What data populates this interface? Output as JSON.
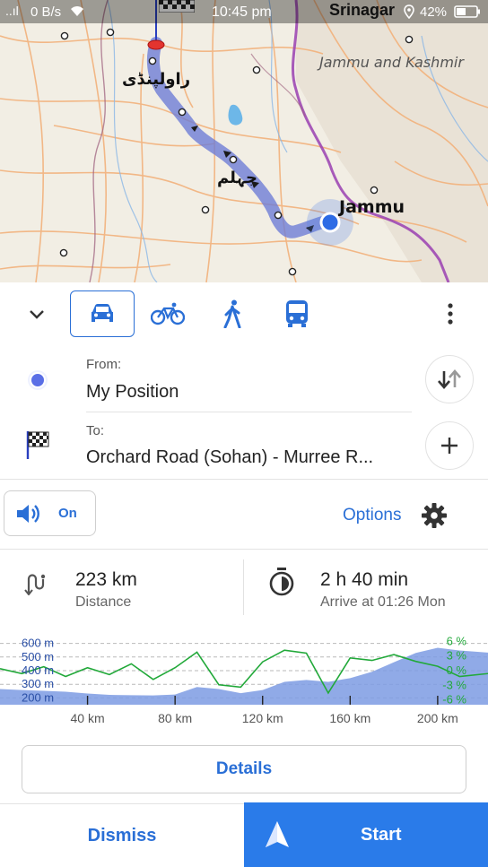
{
  "status_bar": {
    "signal": "..ıl",
    "net_speed": "0 B/s",
    "time": "10:45 pm",
    "location_label": "Srinagar",
    "battery": "42%"
  },
  "map": {
    "labels": {
      "region": "Jammu and Kashmir",
      "city_jammu": "Jammu",
      "city_rawalpindi": "راولپنڈی",
      "city_jhelum": "جہلم"
    }
  },
  "transport_modes": [
    {
      "name": "car",
      "icon": "car-icon",
      "selected": true
    },
    {
      "name": "bicycle",
      "icon": "bicycle-icon",
      "selected": false
    },
    {
      "name": "pedestrian",
      "icon": "walk-icon",
      "selected": false
    },
    {
      "name": "public-transport",
      "icon": "bus-icon",
      "selected": false
    }
  ],
  "route": {
    "from_label": "From:",
    "from_value": "My Position",
    "to_label": "To:",
    "to_value": "Orchard Road (Sohan) - Murree R..."
  },
  "voice": {
    "label": "On"
  },
  "options_label": "Options",
  "stats": {
    "distance_value": "223 km",
    "distance_label": "Distance",
    "time_value": "2 h 40 min",
    "time_label": "Arrive at 01:26 Mon"
  },
  "chart_data": {
    "type": "area",
    "title": "",
    "xlabel": "",
    "ylabel": "",
    "x_ticks": [
      "40 km",
      "80 km",
      "120 km",
      "160 km",
      "200 km"
    ],
    "y_ticks_left": [
      "600 m",
      "500 m",
      "400 m",
      "300 m",
      "200 m"
    ],
    "y_ticks_right": [
      "6 %",
      "3 %",
      "0 %",
      "-3 %",
      "-6 %"
    ],
    "xlim": [
      0,
      223
    ],
    "ylim": [
      150,
      650
    ],
    "series": [
      {
        "x": [
          0,
          10,
          20,
          30,
          40,
          50,
          60,
          70,
          80,
          90,
          100,
          110,
          120,
          130,
          140,
          150,
          160,
          170,
          180,
          190,
          200,
          210,
          223
        ],
        "values": [
          265,
          258,
          252,
          245,
          232,
          222,
          220,
          218,
          225,
          280,
          265,
          235,
          258,
          318,
          332,
          318,
          345,
          392,
          462,
          530,
          568,
          548,
          532
        ]
      },
      {
        "x": [
          0,
          10,
          20,
          30,
          40,
          50,
          60,
          70,
          80,
          90,
          100,
          110,
          120,
          130,
          140,
          150,
          160,
          170,
          180,
          190,
          200,
          210,
          223
        ],
        "values": [
          0.4,
          -0.6,
          0.8,
          -1.2,
          0.6,
          -0.8,
          1.4,
          -1.8,
          0.6,
          3.8,
          -2.9,
          -3.4,
          1.8,
          4.2,
          3.6,
          -4.6,
          2.6,
          2.1,
          3.3,
          1.9,
          0.9,
          -1.2,
          -0.6
        ]
      }
    ]
  },
  "buttons": {
    "details": "Details",
    "dismiss": "Dismiss",
    "start": "Start"
  },
  "colors": {
    "accent": "#2a6fd6",
    "route": "#6b7bd6",
    "elevation_fill": "#7d9be3",
    "slope_line": "#22a93a",
    "start_bg": "#2a7be9"
  }
}
